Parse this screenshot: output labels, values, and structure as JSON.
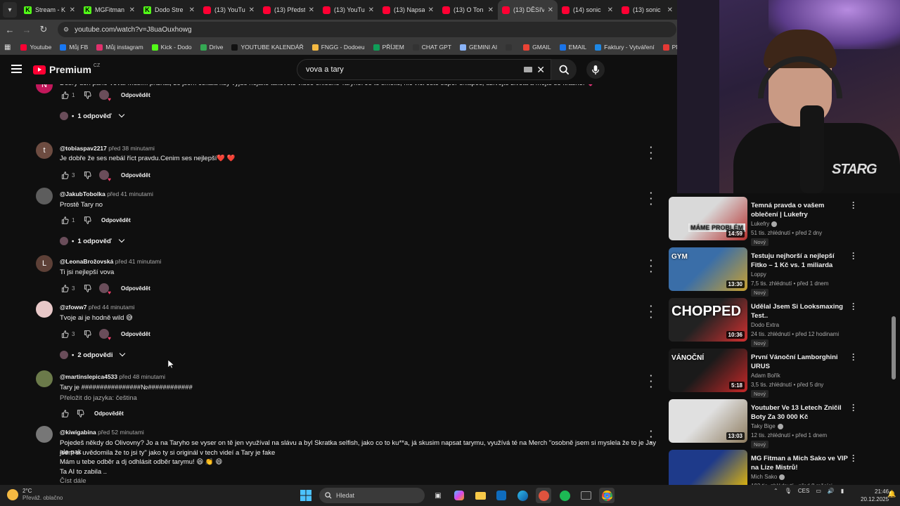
{
  "browser": {
    "tabs": [
      {
        "title": "Stream - K",
        "icon": "kick"
      },
      {
        "title": "MGFitman",
        "icon": "kick"
      },
      {
        "title": "Dodo Stre",
        "icon": "kick"
      },
      {
        "title": "(13) YouTu",
        "icon": "youtube"
      },
      {
        "title": "(13) Předst",
        "icon": "youtube"
      },
      {
        "title": "(13) YouTu",
        "icon": "youtube"
      },
      {
        "title": "(13) Napsa",
        "icon": "youtube"
      },
      {
        "title": "(13) O Ton",
        "icon": "youtube"
      },
      {
        "title": "(13) DĚSIV",
        "icon": "youtube",
        "active": true
      },
      {
        "title": "(14) sonic",
        "icon": "youtube"
      },
      {
        "title": "(13) sonic",
        "icon": "youtube"
      }
    ],
    "url": "youtube.com/watch?v=J8uaOuxhowg",
    "bookmarks": [
      "Youtube",
      "Můj FB",
      "Můj instagram",
      "Kick - Dodo",
      "Drive",
      "YOUTUBE KALENDÁŘ",
      "FNGG - Dodoeu",
      "PŘÍJEM",
      "CHAT GPT",
      "GEMINI AI",
      "",
      "GMAIL",
      "EMAIL",
      "Faktury - Vytváření",
      "PNG to"
    ]
  },
  "yt": {
    "logo": "Premium",
    "region": "CZ",
    "search_value": "vova a tary"
  },
  "comments": [
    {
      "avatar_letter": "N",
      "avatar_color": "#c2185b",
      "user": "",
      "time": "",
      "text": "Dobrý den pane Vova. Musím přiznat, že jsem čekala kdy vyjde nějaké takovéto video ohledně Taryho. Je to šmelič, nic víc. Jste super chlapec, užívejte života a mějte se krásně! 💗",
      "likes": "1",
      "heart": true,
      "reply": "Odpovědět",
      "replies": "1 odpověď"
    },
    {
      "avatar_letter": "t",
      "avatar_color": "#6d4c41",
      "user": "@tobiaspav2217",
      "time": "před 38 minutami",
      "text": "Je dobře že ses nebál říct pravdu.Cenim ses nejlepší❤️ ❤️",
      "likes": "3",
      "heart": true,
      "reply": "Odpovědět"
    },
    {
      "avatar_letter": "",
      "avatar_color": "#5d5d5d",
      "user": "@JakubTobolka",
      "time": "před 41 minutami",
      "text": "Prostě Tary no",
      "likes": "1",
      "heart": false,
      "reply": "Odpovědět",
      "replies": "1 odpověď"
    },
    {
      "avatar_letter": "L",
      "avatar_color": "#5d4037",
      "user": "@LeonaBrožovská",
      "time": "před 41 minutami",
      "text": "Ti jsi nejlepší vova",
      "likes": "3",
      "heart": true,
      "reply": "Odpovědět"
    },
    {
      "avatar_letter": "",
      "avatar_color": "#e8c8c8",
      "user": "@zfoww7",
      "time": "před 44 minutami",
      "text": "Tvoje ai je hodně wild 😅",
      "likes": "3",
      "heart": true,
      "reply": "Odpovědět",
      "replies": "2 odpovědi"
    },
    {
      "avatar_letter": "",
      "avatar_color": "#6b7a4a",
      "user": "@martinslepica4533",
      "time": "před 48 minutami",
      "text": "Tary je ################№############",
      "translate": "Přeložit do jazyka: čeština",
      "likes": "",
      "heart": false,
      "reply": "Odpovědět"
    },
    {
      "avatar_letter": "",
      "avatar_color": "#777777",
      "user": "@kiwigabina",
      "time": "před 52 minutami",
      "text_lines": [
        "Pojedeš někdy do Olivovny? Jo a na Taryho se vyser on tě jen využíval na slávu a byl Skratka selfish, jako co to ku**a, já skusim napsat tarymu, využívá té na Merch \"osobně jsem si myslela že to je Jay ale pak",
        "jsem si uvědomila že to jsi ty\" jako ty si originál v tech videí a Tary je fake",
        "Mám u tebe odběr a dj odhlásit odběr tarymu! 😆 👏 😄",
        "Ta AI to zabila ..",
        "Číst dále"
      ]
    }
  ],
  "recommended": [
    {
      "title": "Temná pravda o vašem oblečení | Lukefry",
      "channel": "Lukefry",
      "verified": true,
      "stats": "51 tis. zhlédnutí • před 2 dny",
      "badge": "Nový",
      "duration": "14:59",
      "thumb_text": "MÁME PROBLÉM",
      "thumb_colors": [
        "#d9d9d9",
        "#b5312f"
      ]
    },
    {
      "title": "Testuju nejhorší a nejlepší Fitko – 1 Kč vs. 1 miliarda",
      "channel": "Loppy",
      "verified": false,
      "stats": "7,5 tis. zhlédnutí • před 1 dnem",
      "badge": "Nový",
      "duration": "13:30",
      "thumb_text": "GYM",
      "thumb_colors": [
        "#3a6ea8",
        "#c9a030"
      ]
    },
    {
      "title": "Udělal Jsem Si Looksmaxing Test..",
      "channel": "Dodo Extra",
      "verified": false,
      "stats": "24 tis. zhlédnutí • před 12 hodinami",
      "badge": "Nový",
      "duration": "10:36",
      "thumb_text": "CHOPPED",
      "thumb_colors": [
        "#222222",
        "#d23030"
      ]
    },
    {
      "title": "První Vánoční Lamborghini URUS",
      "channel": "Adam Bořík",
      "verified": false,
      "stats": "3,5 tis. zhlédnutí • před 5 dny",
      "badge": "Nový",
      "duration": "5:18",
      "thumb_text": "VÁNOČNÍ",
      "thumb_colors": [
        "#1a1a1a",
        "#c62828"
      ]
    },
    {
      "title": "Youtuber Ve 13 Letech Zničil Boty Za 30 000 Kč",
      "channel": "Taky Bige",
      "verified": true,
      "stats": "12 tis. zhlédnutí • před 1 dnem",
      "badge": "Nový",
      "duration": "13:03",
      "thumb_text": "",
      "thumb_colors": [
        "#e0e0e0",
        "#8d7b5e"
      ]
    },
    {
      "title": "MG Fitman a Mich Sako ve VIP na Lize Mistrů!",
      "channel": "Mich Sako",
      "verified": true,
      "stats": "193 tis. zhlédnutí • před 8 měsíci",
      "badge": "",
      "duration": "",
      "thumb_text": "",
      "thumb_colors": [
        "#1e3a8a",
        "#f0c000"
      ]
    }
  ],
  "overlay": {
    "shirt_text": "STARG"
  },
  "taskbar": {
    "temp": "2°C",
    "weather": "Převáž. oblačno",
    "search_placeholder": "Hledat",
    "lang": "CES",
    "time": "21:46",
    "date": "20.12.2025"
  }
}
